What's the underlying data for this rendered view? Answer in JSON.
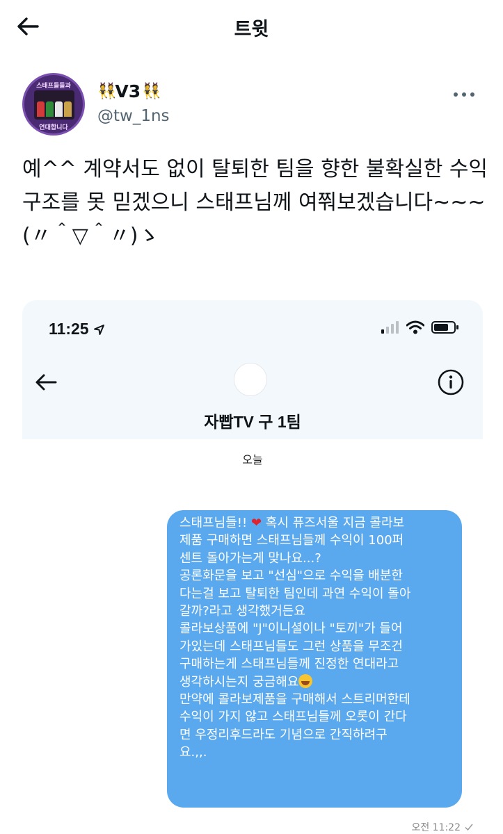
{
  "page_title": "트윗",
  "tweet": {
    "display_name": "V3",
    "handle": "@tw_1ns",
    "avatar": {
      "top_text": "스태프들들과",
      "bottom_text": "연대합니다"
    },
    "text": "예^^ 계약서도 없이 탈퇴한 팀을 향한 불확실한 수익구조를 못 믿겠으니 스태프님께 여쭤보겠습니다~~~(〃＾▽＾〃)ゝ"
  },
  "attached_screenshot": {
    "status_time": "11:25",
    "chat_name": "자빱TV 구 1팀",
    "date_label": "오늘",
    "message_lines": [
      "스태프님들!! ❤️ 혹시 퓨즈서울 지금 콜라보",
      "제품 구매하면 스태프님들께 수익이 100퍼",
      "센트 돌아가는게 맞나요...?",
      "공론화문을 보고 \"선심\"으로 수익을 배분한",
      "다는걸 보고 탈퇴한 팀인데 과연 수익이 돌아",
      "갈까?라고 생각했거든요",
      "콜라보상품에 \"J\"이니셜이나 \"토끼\"가 들어",
      "가있는데 스태프님들도 그런 상품을 무조건",
      "구매하는게 스태프님들께 진정한 연대라고",
      "생각하시는지 궁금해요",
      "만약에 콜라보제품을 구매해서 스트리머한테",
      "수익이 가지 않고 스태프님들께 오롯이 간다",
      "면 우정리후드라도 기념으로 간직하려구",
      "요.,,."
    ],
    "timestamp": "오전 11:22"
  },
  "colors": {
    "bubble": "#5aa9ee",
    "accent": "#1d9bf0"
  },
  "icons": [
    "back-arrow-icon",
    "more-icon",
    "location-arrow-icon",
    "signal-icon",
    "wifi-icon",
    "battery-icon",
    "info-icon",
    "heart-emoji-icon",
    "grin-emoji-icon",
    "check-icon"
  ]
}
